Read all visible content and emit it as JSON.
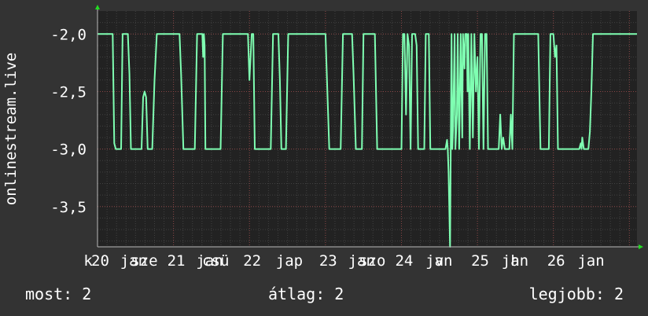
{
  "chart_data": {
    "type": "line",
    "ylabel": "onlinestream.live",
    "ylim": [
      -3.85,
      -1.8
    ],
    "yticks": [
      {
        "value": -2.0,
        "label": "-2,0"
      },
      {
        "value": -2.5,
        "label": "-2,5"
      },
      {
        "value": -3.0,
        "label": "-3,0"
      },
      {
        "value": -3.5,
        "label": "-3,5"
      }
    ],
    "x_range": [
      0,
      7.1
    ],
    "x_labels": [
      {
        "value": -0.1,
        "text": "k"
      },
      {
        "value": 0.0,
        "text": "20"
      },
      {
        "value": 0.38,
        "text": "jan"
      },
      {
        "value": 0.52,
        "text": "sze"
      },
      {
        "value": 1.0,
        "text": "21"
      },
      {
        "value": 1.38,
        "text": "jan"
      },
      {
        "value": 1.46,
        "text": "csü"
      },
      {
        "value": 2.0,
        "text": "22"
      },
      {
        "value": 2.43,
        "text": "jap"
      },
      {
        "value": 3.0,
        "text": "23"
      },
      {
        "value": 3.38,
        "text": "jan"
      },
      {
        "value": 3.52,
        "text": "szo"
      },
      {
        "value": 4.0,
        "text": "24"
      },
      {
        "value": 4.4,
        "text": "jan"
      },
      {
        "value": 4.52,
        "text": "v"
      },
      {
        "value": 5.0,
        "text": "25"
      },
      {
        "value": 5.4,
        "text": "jan"
      },
      {
        "value": 5.52,
        "text": "h"
      },
      {
        "value": 6.0,
        "text": "26"
      },
      {
        "value": 6.4,
        "text": "jan"
      }
    ],
    "grid": true,
    "series": [
      {
        "color": "#7fffb2",
        "points": [
          [
            0.0,
            -2.0
          ],
          [
            0.2,
            -2.0
          ],
          [
            0.22,
            -2.95
          ],
          [
            0.24,
            -3.0
          ],
          [
            0.31,
            -3.0
          ],
          [
            0.33,
            -2.0
          ],
          [
            0.4,
            -2.0
          ],
          [
            0.42,
            -2.35
          ],
          [
            0.44,
            -3.0
          ],
          [
            0.58,
            -3.0
          ],
          [
            0.6,
            -2.55
          ],
          [
            0.62,
            -2.5
          ],
          [
            0.64,
            -2.55
          ],
          [
            0.66,
            -3.0
          ],
          [
            0.72,
            -3.0
          ],
          [
            0.75,
            -2.4
          ],
          [
            0.78,
            -2.0
          ],
          [
            1.08,
            -2.0
          ],
          [
            1.1,
            -2.35
          ],
          [
            1.13,
            -3.0
          ],
          [
            1.28,
            -3.0
          ],
          [
            1.31,
            -2.0
          ],
          [
            1.38,
            -2.0
          ],
          [
            1.39,
            -2.2
          ],
          [
            1.4,
            -2.0
          ],
          [
            1.41,
            -2.1
          ],
          [
            1.42,
            -3.0
          ],
          [
            1.62,
            -3.0
          ],
          [
            1.65,
            -2.0
          ],
          [
            1.98,
            -2.0
          ],
          [
            2.0,
            -2.4
          ],
          [
            2.03,
            -2.0
          ],
          [
            2.05,
            -2.0
          ],
          [
            2.07,
            -3.0
          ],
          [
            2.28,
            -3.0
          ],
          [
            2.31,
            -2.0
          ],
          [
            2.38,
            -2.0
          ],
          [
            2.4,
            -2.4
          ],
          [
            2.42,
            -3.0
          ],
          [
            2.48,
            -3.0
          ],
          [
            2.51,
            -2.0
          ],
          [
            3.0,
            -2.0
          ],
          [
            3.02,
            -2.4
          ],
          [
            3.05,
            -3.0
          ],
          [
            3.2,
            -3.0
          ],
          [
            3.23,
            -2.0
          ],
          [
            3.35,
            -2.0
          ],
          [
            3.37,
            -2.35
          ],
          [
            3.4,
            -3.0
          ],
          [
            3.48,
            -3.0
          ],
          [
            3.5,
            -2.0
          ],
          [
            3.65,
            -2.0
          ],
          [
            3.68,
            -3.0
          ],
          [
            4.0,
            -3.0
          ],
          [
            4.02,
            -2.0
          ],
          [
            4.04,
            -2.0
          ],
          [
            4.06,
            -2.7
          ],
          [
            4.08,
            -2.0
          ],
          [
            4.1,
            -2.1
          ],
          [
            4.12,
            -3.0
          ],
          [
            4.14,
            -2.0
          ],
          [
            4.18,
            -2.0
          ],
          [
            4.2,
            -2.1
          ],
          [
            4.22,
            -3.0
          ],
          [
            4.3,
            -3.0
          ],
          [
            4.32,
            -2.0
          ],
          [
            4.36,
            -2.0
          ],
          [
            4.38,
            -3.0
          ],
          [
            4.58,
            -3.0
          ],
          [
            4.6,
            -2.92
          ],
          [
            4.61,
            -3.0
          ],
          [
            4.62,
            -3.2
          ],
          [
            4.64,
            -3.85
          ],
          [
            4.66,
            -2.0
          ],
          [
            4.67,
            -3.0
          ],
          [
            4.68,
            -2.8
          ],
          [
            4.7,
            -2.0
          ],
          [
            4.71,
            -3.0
          ],
          [
            4.73,
            -2.7
          ],
          [
            4.74,
            -2.0
          ],
          [
            4.76,
            -3.0
          ],
          [
            4.78,
            -2.0
          ],
          [
            4.8,
            -2.9
          ],
          [
            4.81,
            -2.0
          ],
          [
            4.83,
            -2.3
          ],
          [
            4.84,
            -2.0
          ],
          [
            4.86,
            -2.0
          ],
          [
            4.87,
            -2.5
          ],
          [
            4.88,
            -2.0
          ],
          [
            4.9,
            -3.0
          ],
          [
            4.92,
            -2.0
          ],
          [
            4.94,
            -2.9
          ],
          [
            4.96,
            -2.0
          ],
          [
            4.98,
            -2.5
          ],
          [
            5.0,
            -2.2
          ],
          [
            5.02,
            -3.0
          ],
          [
            5.04,
            -2.0
          ],
          [
            5.06,
            -2.0
          ],
          [
            5.08,
            -3.0
          ],
          [
            5.1,
            -2.0
          ],
          [
            5.12,
            -2.0
          ],
          [
            5.14,
            -3.0
          ],
          [
            5.28,
            -3.0
          ],
          [
            5.3,
            -2.7
          ],
          [
            5.32,
            -3.0
          ],
          [
            5.34,
            -2.9
          ],
          [
            5.36,
            -3.0
          ],
          [
            5.42,
            -3.0
          ],
          [
            5.44,
            -2.7
          ],
          [
            5.46,
            -3.0
          ],
          [
            5.48,
            -2.0
          ],
          [
            5.8,
            -2.0
          ],
          [
            5.83,
            -3.0
          ],
          [
            5.94,
            -3.0
          ],
          [
            5.96,
            -2.0
          ],
          [
            6.0,
            -2.0
          ],
          [
            6.02,
            -2.2
          ],
          [
            6.04,
            -2.1
          ],
          [
            6.06,
            -3.0
          ],
          [
            6.34,
            -3.0
          ],
          [
            6.36,
            -2.95
          ],
          [
            6.37,
            -3.0
          ],
          [
            6.38,
            -2.9
          ],
          [
            6.4,
            -3.0
          ],
          [
            6.46,
            -3.0
          ],
          [
            6.48,
            -2.85
          ],
          [
            6.5,
            -2.5
          ],
          [
            6.52,
            -2.0
          ],
          [
            7.1,
            -2.0
          ]
        ]
      }
    ]
  },
  "stats": {
    "now": "most: 2",
    "avg": "átlag: 2",
    "max": "legjobb: 2"
  },
  "colors": {
    "background": "#333333",
    "plot": "#222222",
    "grid": "#555555",
    "line": "#7fffb2",
    "arrow": "#22dd22"
  }
}
